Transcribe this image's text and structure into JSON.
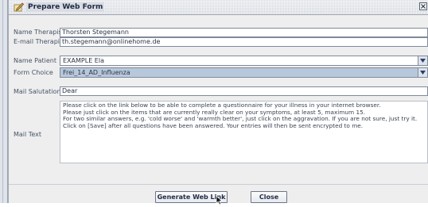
{
  "window": {
    "title": "Prepare Web Form"
  },
  "form": {
    "name_therapist": {
      "label": "Name Therapist",
      "value": "Thorsten Stegemann"
    },
    "email_therapist": {
      "label": "E-mail Therapist",
      "value": "th.stegemann@onlinehome.de"
    },
    "name_patient": {
      "label": "Name Patient",
      "value": "EXAMPLE Ela"
    },
    "form_choice": {
      "label": "Form Choice",
      "value": "Frei_14_AD_Influenza"
    },
    "mail_salutation": {
      "label": "Mail Salutation",
      "value": "Dear"
    },
    "mail_text": {
      "label": "Mail Text",
      "lines": [
        "Please click on the link below to be able to complete a questionnaire for your illness in your internet browser.",
        "Please just click on the items that are currently really clear on your symptoms, at least 5, maximum 15.",
        "For two similar answers, e.g. 'cold worse' and 'warmth better', just click on the aggravation. If you are not sure, just try it.",
        "Click on [Save] after all questions have been answered. Your entries will then be sent encrypted to me."
      ]
    }
  },
  "buttons": {
    "generate": "Generate Web Link",
    "close": "Close"
  },
  "colors": {
    "highlight_combo": "#b8c8dc",
    "title_text": "#1f2a44"
  },
  "icons": {
    "title": "pen-paper-icon",
    "close": "close-icon",
    "dropdown": "chevron-down-icon",
    "cursor": "mouse-pointer-icon"
  }
}
